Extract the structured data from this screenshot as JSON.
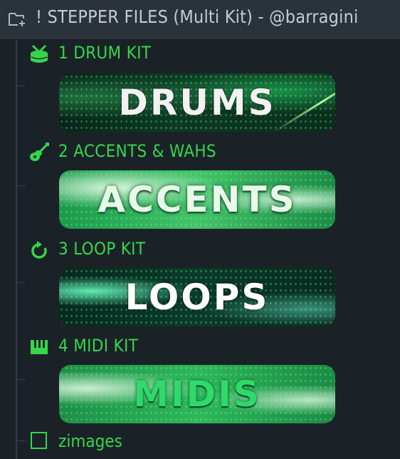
{
  "header": {
    "title": "! STEPPER FILES (Multi Kit) - @barragini",
    "icon": "add-folder-icon"
  },
  "colors": {
    "accent": "#35d64c",
    "background": "#1b2227",
    "header_bg": "#2a3339"
  },
  "folders": [
    {
      "label": "1 DRUM KIT",
      "icon": "drum-icon",
      "banner_text": "DRUMS"
    },
    {
      "label": "2 ACCENTS & WAHS",
      "icon": "guitar-icon",
      "banner_text": "ACCENTS"
    },
    {
      "label": "3 LOOP KIT",
      "icon": "loop-icon",
      "banner_text": "LOOPS"
    },
    {
      "label": "4 MIDI KIT",
      "icon": "piano-icon",
      "banner_text": "MIDIS"
    }
  ],
  "extra_item": {
    "label": "zimages",
    "icon": "empty-box-icon"
  }
}
